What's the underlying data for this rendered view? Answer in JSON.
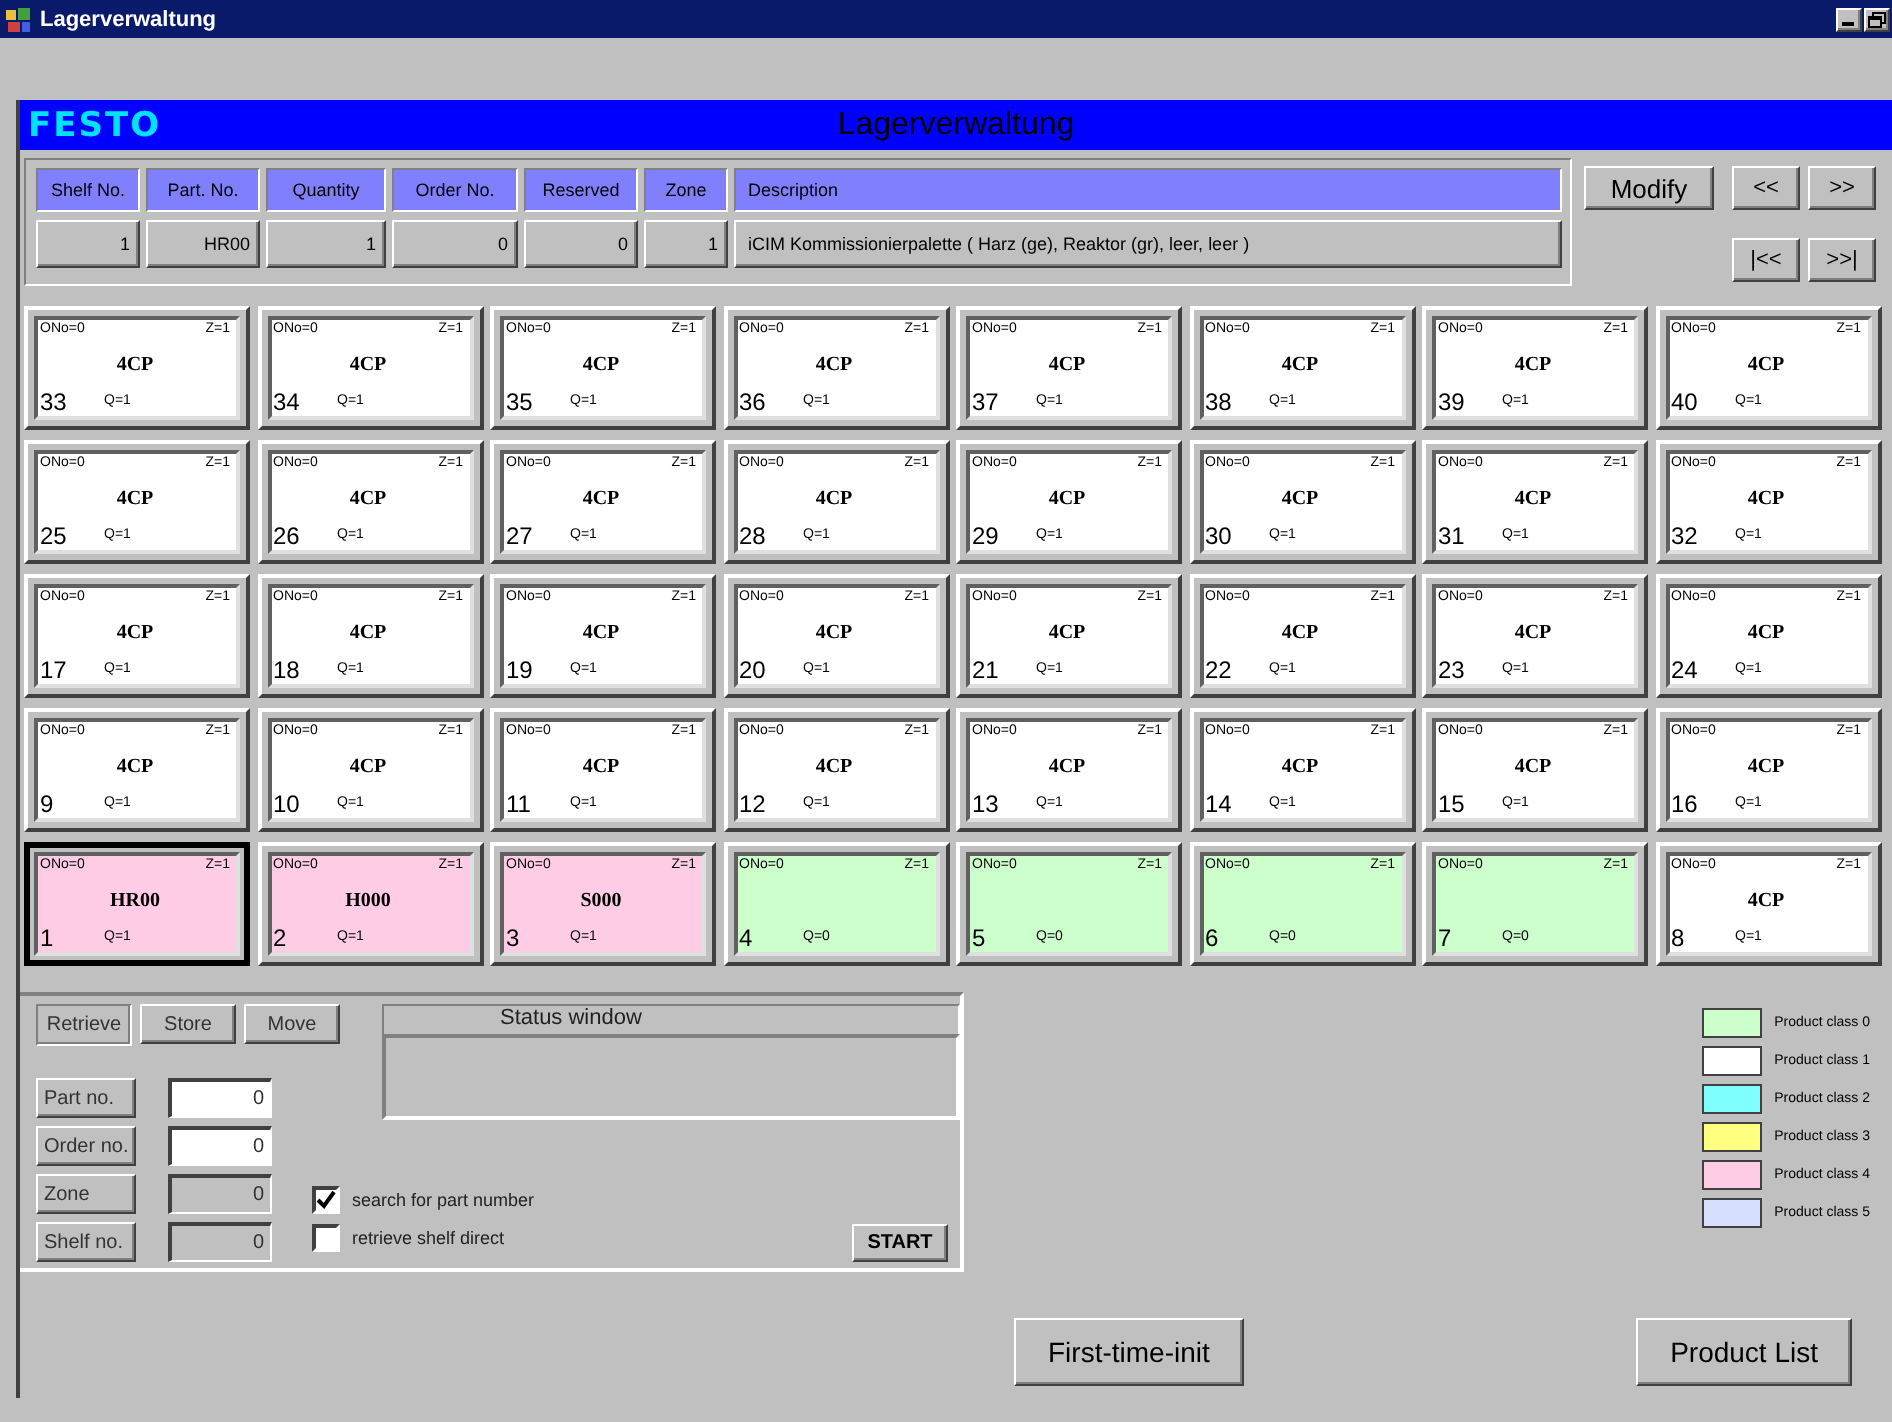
{
  "window": {
    "title": "Lagerverwaltung"
  },
  "header": {
    "logo": "FESTO",
    "title": "Lagerverwaltung"
  },
  "info": {
    "columns": [
      "Shelf No.",
      "Part. No.",
      "Quantity",
      "Order No.",
      "Reserved",
      "Zone",
      "Description"
    ],
    "values": [
      "1",
      "HR00",
      "1",
      "0",
      "0",
      "1",
      "iCIM Kommissionierpalette ( Harz (ge), Reaktor (gr), leer, leer )"
    ]
  },
  "modify_button": "Modify",
  "nav_buttons": [
    "<<",
    ">>",
    "|<<",
    ">>|"
  ],
  "shelves": [
    {
      "number": "33",
      "ono": "ONo=0",
      "zone": "Z=1",
      "part": "4CP",
      "quantity": "Q=1",
      "color": "#ffffff",
      "selected": false
    },
    {
      "number": "34",
      "ono": "ONo=0",
      "zone": "Z=1",
      "part": "4CP",
      "quantity": "Q=1",
      "color": "#ffffff",
      "selected": false
    },
    {
      "number": "35",
      "ono": "ONo=0",
      "zone": "Z=1",
      "part": "4CP",
      "quantity": "Q=1",
      "color": "#ffffff",
      "selected": false
    },
    {
      "number": "36",
      "ono": "ONo=0",
      "zone": "Z=1",
      "part": "4CP",
      "quantity": "Q=1",
      "color": "#ffffff",
      "selected": false
    },
    {
      "number": "37",
      "ono": "ONo=0",
      "zone": "Z=1",
      "part": "4CP",
      "quantity": "Q=1",
      "color": "#ffffff",
      "selected": false
    },
    {
      "number": "38",
      "ono": "ONo=0",
      "zone": "Z=1",
      "part": "4CP",
      "quantity": "Q=1",
      "color": "#ffffff",
      "selected": false
    },
    {
      "number": "39",
      "ono": "ONo=0",
      "zone": "Z=1",
      "part": "4CP",
      "quantity": "Q=1",
      "color": "#ffffff",
      "selected": false
    },
    {
      "number": "40",
      "ono": "ONo=0",
      "zone": "Z=1",
      "part": "4CP",
      "quantity": "Q=1",
      "color": "#ffffff",
      "selected": false
    },
    {
      "number": "25",
      "ono": "ONo=0",
      "zone": "Z=1",
      "part": "4CP",
      "quantity": "Q=1",
      "color": "#ffffff",
      "selected": false
    },
    {
      "number": "26",
      "ono": "ONo=0",
      "zone": "Z=1",
      "part": "4CP",
      "quantity": "Q=1",
      "color": "#ffffff",
      "selected": false
    },
    {
      "number": "27",
      "ono": "ONo=0",
      "zone": "Z=1",
      "part": "4CP",
      "quantity": "Q=1",
      "color": "#ffffff",
      "selected": false
    },
    {
      "number": "28",
      "ono": "ONo=0",
      "zone": "Z=1",
      "part": "4CP",
      "quantity": "Q=1",
      "color": "#ffffff",
      "selected": false
    },
    {
      "number": "29",
      "ono": "ONo=0",
      "zone": "Z=1",
      "part": "4CP",
      "quantity": "Q=1",
      "color": "#ffffff",
      "selected": false
    },
    {
      "number": "30",
      "ono": "ONo=0",
      "zone": "Z=1",
      "part": "4CP",
      "quantity": "Q=1",
      "color": "#ffffff",
      "selected": false
    },
    {
      "number": "31",
      "ono": "ONo=0",
      "zone": "Z=1",
      "part": "4CP",
      "quantity": "Q=1",
      "color": "#ffffff",
      "selected": false
    },
    {
      "number": "32",
      "ono": "ONo=0",
      "zone": "Z=1",
      "part": "4CP",
      "quantity": "Q=1",
      "color": "#ffffff",
      "selected": false
    },
    {
      "number": "17",
      "ono": "ONo=0",
      "zone": "Z=1",
      "part": "4CP",
      "quantity": "Q=1",
      "color": "#ffffff",
      "selected": false
    },
    {
      "number": "18",
      "ono": "ONo=0",
      "zone": "Z=1",
      "part": "4CP",
      "quantity": "Q=1",
      "color": "#ffffff",
      "selected": false
    },
    {
      "number": "19",
      "ono": "ONo=0",
      "zone": "Z=1",
      "part": "4CP",
      "quantity": "Q=1",
      "color": "#ffffff",
      "selected": false
    },
    {
      "number": "20",
      "ono": "ONo=0",
      "zone": "Z=1",
      "part": "4CP",
      "quantity": "Q=1",
      "color": "#ffffff",
      "selected": false
    },
    {
      "number": "21",
      "ono": "ONo=0",
      "zone": "Z=1",
      "part": "4CP",
      "quantity": "Q=1",
      "color": "#ffffff",
      "selected": false
    },
    {
      "number": "22",
      "ono": "ONo=0",
      "zone": "Z=1",
      "part": "4CP",
      "quantity": "Q=1",
      "color": "#ffffff",
      "selected": false
    },
    {
      "number": "23",
      "ono": "ONo=0",
      "zone": "Z=1",
      "part": "4CP",
      "quantity": "Q=1",
      "color": "#ffffff",
      "selected": false
    },
    {
      "number": "24",
      "ono": "ONo=0",
      "zone": "Z=1",
      "part": "4CP",
      "quantity": "Q=1",
      "color": "#ffffff",
      "selected": false
    },
    {
      "number": "9",
      "ono": "ONo=0",
      "zone": "Z=1",
      "part": "4CP",
      "quantity": "Q=1",
      "color": "#ffffff",
      "selected": false
    },
    {
      "number": "10",
      "ono": "ONo=0",
      "zone": "Z=1",
      "part": "4CP",
      "quantity": "Q=1",
      "color": "#ffffff",
      "selected": false
    },
    {
      "number": "11",
      "ono": "ONo=0",
      "zone": "Z=1",
      "part": "4CP",
      "quantity": "Q=1",
      "color": "#ffffff",
      "selected": false
    },
    {
      "number": "12",
      "ono": "ONo=0",
      "zone": "Z=1",
      "part": "4CP",
      "quantity": "Q=1",
      "color": "#ffffff",
      "selected": false
    },
    {
      "number": "13",
      "ono": "ONo=0",
      "zone": "Z=1",
      "part": "4CP",
      "quantity": "Q=1",
      "color": "#ffffff",
      "selected": false
    },
    {
      "number": "14",
      "ono": "ONo=0",
      "zone": "Z=1",
      "part": "4CP",
      "quantity": "Q=1",
      "color": "#ffffff",
      "selected": false
    },
    {
      "number": "15",
      "ono": "ONo=0",
      "zone": "Z=1",
      "part": "4CP",
      "quantity": "Q=1",
      "color": "#ffffff",
      "selected": false
    },
    {
      "number": "16",
      "ono": "ONo=0",
      "zone": "Z=1",
      "part": "4CP",
      "quantity": "Q=1",
      "color": "#ffffff",
      "selected": false
    },
    {
      "number": "1",
      "ono": "ONo=0",
      "zone": "Z=1",
      "part": "HR00",
      "quantity": "Q=1",
      "color": "#ffcce6",
      "selected": true
    },
    {
      "number": "2",
      "ono": "ONo=0",
      "zone": "Z=1",
      "part": "H000",
      "quantity": "Q=1",
      "color": "#ffcce6",
      "selected": false
    },
    {
      "number": "3",
      "ono": "ONo=0",
      "zone": "Z=1",
      "part": "S000",
      "quantity": "Q=1",
      "color": "#ffcce6",
      "selected": false
    },
    {
      "number": "4",
      "ono": "ONo=0",
      "zone": "Z=1",
      "quantity": "Q=0",
      "color": "#ccffcc",
      "selected": false
    },
    {
      "number": "5",
      "ono": "ONo=0",
      "zone": "Z=1",
      "quantity": "Q=0",
      "color": "#ccffcc",
      "selected": false
    },
    {
      "number": "6",
      "ono": "ONo=0",
      "zone": "Z=1",
      "quantity": "Q=0",
      "color": "#ccffcc",
      "selected": false
    },
    {
      "number": "7",
      "ono": "ONo=0",
      "zone": "Z=1",
      "quantity": "Q=0",
      "color": "#ccffcc",
      "selected": false
    },
    {
      "number": "8",
      "ono": "ONo=0",
      "zone": "Z=1",
      "part": "4CP",
      "quantity": "Q=1",
      "color": "#ffffff",
      "selected": false
    }
  ],
  "operations": [
    {
      "label": "Retrieve",
      "selected": true
    },
    {
      "label": "Store",
      "selected": false
    },
    {
      "label": "Move",
      "selected": false
    }
  ],
  "status_window": {
    "title": "Status window"
  },
  "fields": [
    {
      "label": "Part no.",
      "value": "0",
      "disabled": false
    },
    {
      "label": "Order no.",
      "value": "0",
      "disabled": false
    },
    {
      "label": "Zone",
      "value": "0",
      "disabled": true
    },
    {
      "label": "Shelf no.",
      "value": "0",
      "disabled": true
    }
  ],
  "options": [
    {
      "label": "search for part number",
      "checked": true
    },
    {
      "label": "retrieve shelf direct",
      "checked": false
    }
  ],
  "start_button": "START",
  "legend": [
    {
      "label": "Product class 0",
      "color": "#ccffcc"
    },
    {
      "label": "Product class 1",
      "color": "#ffffff"
    },
    {
      "label": "Product class 2",
      "color": "#80ffff"
    },
    {
      "label": "Product class 3",
      "color": "#ffff80"
    },
    {
      "label": "Product class 4",
      "color": "#ffcce6"
    },
    {
      "label": "Product class 5",
      "color": "#d8e0ff"
    }
  ],
  "bottom_buttons": [
    "First-time-init",
    "Product List"
  ]
}
